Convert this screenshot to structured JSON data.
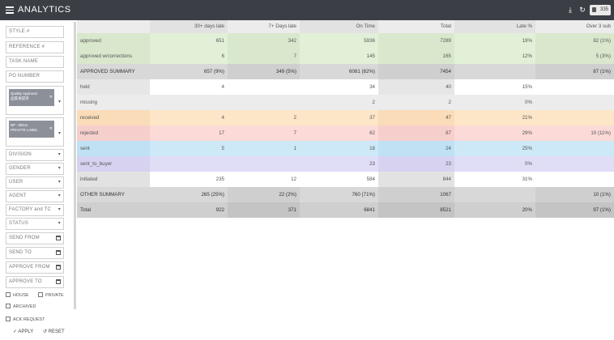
{
  "header": {
    "title": "ANALYTICS",
    "badge": "335",
    "icons": [
      "menu-icon",
      "download-icon",
      "refresh-icon",
      "lock-icon"
    ]
  },
  "sidebar": {
    "style": "STYLE #",
    "reference": "REFERENCE #",
    "task_name": "TASK NAME",
    "po_number": "PO NUMBER",
    "approval_chip_line1": "Quality Approval",
    "approval_chip_line2": "品質承認済",
    "customer_chip_line1": "BP - BELK",
    "customer_chip_line2": "PRIVATE LABEL",
    "division": "DIVISION",
    "gender": "GENDER",
    "user": "USER",
    "agent": "AGENT",
    "factory": "FACTORY and TC",
    "status": "STATUS",
    "send_from": "SEND FROM",
    "send_to": "SEND TO",
    "approve_from": "APPROVE FROM",
    "approve_to": "APPROVE TO",
    "house": "HOUSE",
    "private": "PRIVATE",
    "archived": "ARCHIVED",
    "ack_request": "ACK REQUEST",
    "apply": "APPLY",
    "reset": "RESET"
  },
  "table": {
    "columns": [
      "30+ days late",
      "7+ Days late",
      "On Time",
      "Total",
      "Late %",
      "Over 3 sub"
    ],
    "rows": [
      {
        "label": "approved",
        "values": [
          "651",
          "342",
          "5936",
          "7289",
          "19%",
          "82 (1%)"
        ]
      },
      {
        "label": "approved w/corrections",
        "values": [
          "6",
          "7",
          "145",
          "165",
          "12%",
          "5 (3%)"
        ]
      },
      {
        "label": "APPROVED SUMMARY",
        "values": [
          "657 (9%)",
          "349 (5%)",
          "6081 (82%)",
          "7454",
          "",
          "87 (1%)"
        ]
      },
      {
        "label": "held",
        "values": [
          "4",
          "",
          "34",
          "40",
          "15%",
          ""
        ]
      },
      {
        "label": "missing",
        "values": [
          "",
          "",
          "2",
          "2",
          "0%",
          ""
        ]
      },
      {
        "label": "received",
        "values": [
          "4",
          "2",
          "37",
          "47",
          "21%",
          ""
        ]
      },
      {
        "label": "rejected",
        "values": [
          "17",
          "7",
          "62",
          "87",
          "29%",
          "10 (11%)"
        ]
      },
      {
        "label": "sent",
        "values": [
          "5",
          "1",
          "18",
          "24",
          "25%",
          ""
        ]
      },
      {
        "label": "sent_to_buyer",
        "values": [
          "",
          "",
          "23",
          "23",
          "0%",
          ""
        ]
      },
      {
        "label": "initiated",
        "values": [
          "235",
          "12",
          "584",
          "844",
          "31%",
          ""
        ]
      },
      {
        "label": "OTHER SUMMARY",
        "values": [
          "265 (25%)",
          "22 (2%)",
          "760 (71%)",
          "1067",
          "",
          "10 (1%)"
        ]
      },
      {
        "label": "Total",
        "values": [
          "922",
          "371",
          "6841",
          "8521",
          "20%",
          "97 (1%)"
        ]
      }
    ]
  }
}
